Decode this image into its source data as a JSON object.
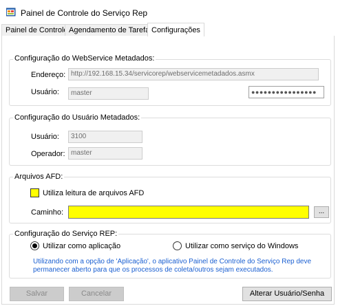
{
  "window": {
    "title": "Painel de Controle do Serviço Rep",
    "icon": "app-window-icon"
  },
  "tabs": [
    {
      "label": "Painel de Controle",
      "active": false
    },
    {
      "label": "Agendamento de Tarefas",
      "active": false
    },
    {
      "label": "Configurações",
      "active": true
    }
  ],
  "webservice": {
    "legend": "Configuração do WebService Metadados:",
    "address_label": "Endereço:",
    "address_value": "http://192.168.15.34/servicorep/webservicemetadados.asmx",
    "user_label": "Usuário:",
    "user_value": "master",
    "password_value": "●●●●●●●●●●●●●●●●"
  },
  "user_config": {
    "legend": "Configuração do Usuário Metadados:",
    "user_label": "Usuário:",
    "user_value": "3100",
    "operator_label": "Operador:",
    "operator_value": "master"
  },
  "afd": {
    "legend": "Arquivos AFD:",
    "checkbox_label": "Utiliza leitura de arquivos AFD",
    "path_label": "Caminho:",
    "path_value": "",
    "browse_label": "..."
  },
  "service": {
    "legend": "Configuração do Serviço REP:",
    "option_app": "Utilizar como aplicação",
    "option_windows": "Utilizar como serviço do Windows",
    "selected": "app",
    "info_line1": "Utilizando com a opção de 'Aplicação', o aplicativo Painel de Controle do Serviço Rep deve",
    "info_line2": "permanecer aberto para que os processos de coleta/outros sejam executados."
  },
  "buttons": {
    "save": "Salvar",
    "cancel": "Cancelar",
    "change_user": "Alterar Usuário/Senha"
  },
  "colors": {
    "highlight_yellow": "#ffff00",
    "info_blue": "#1a5fd1"
  }
}
